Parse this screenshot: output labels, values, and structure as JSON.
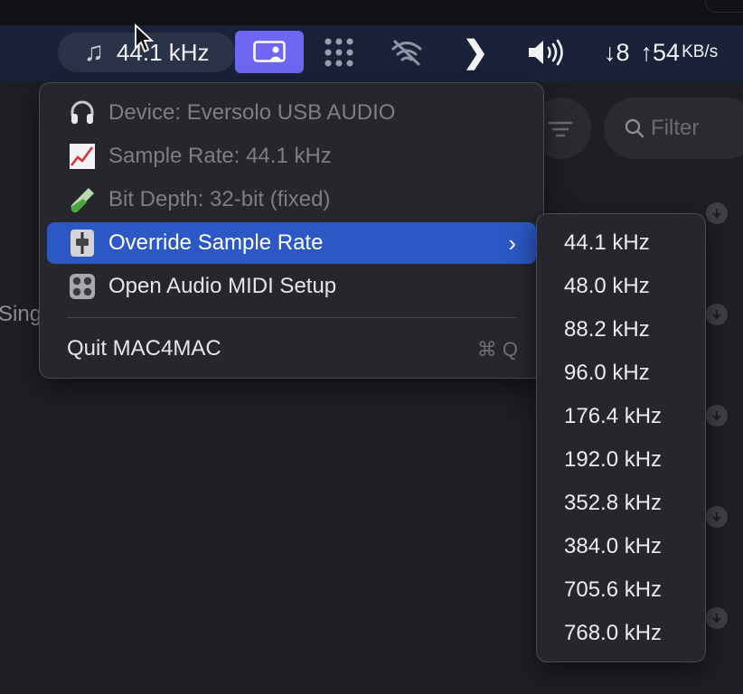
{
  "menubar": {
    "rate_label": "44.1 kHz",
    "net_down": "↓8",
    "net_up": "↑54",
    "net_unit": "KB/s"
  },
  "app": {
    "filter_placeholder": "Filter",
    "partial_row_text": "Sing"
  },
  "menu": {
    "items": [
      {
        "label": "Device: Eversolo USB AUDIO",
        "icon": "headphones-icon",
        "enabled": false
      },
      {
        "label": "Sample Rate: 44.1 kHz",
        "icon": "chart-icon",
        "enabled": false
      },
      {
        "label": "Bit Depth: 32-bit (fixed)",
        "icon": "test-tube-icon",
        "enabled": false
      },
      {
        "label": "Override Sample Rate",
        "icon": "fader-icon",
        "enabled": true,
        "highlighted": true
      },
      {
        "label": "Open Audio MIDI Setup",
        "icon": "midi-setup-icon",
        "enabled": true
      }
    ],
    "quit_label": "Quit MAC4MAC",
    "quit_shortcut": "⌘ Q"
  },
  "submenu": {
    "rates": [
      "44.1 kHz",
      "48.0 kHz",
      "88.2 kHz",
      "96.0 kHz",
      "176.4 kHz",
      "192.0 kHz",
      "352.8 kHz",
      "384.0 kHz",
      "705.6 kHz",
      "768.0 kHz"
    ]
  },
  "colors": {
    "menubar": "#192238",
    "highlight": "#2b58c4",
    "screen_button": "#6f67f2",
    "menu_bg": "#26272c"
  }
}
